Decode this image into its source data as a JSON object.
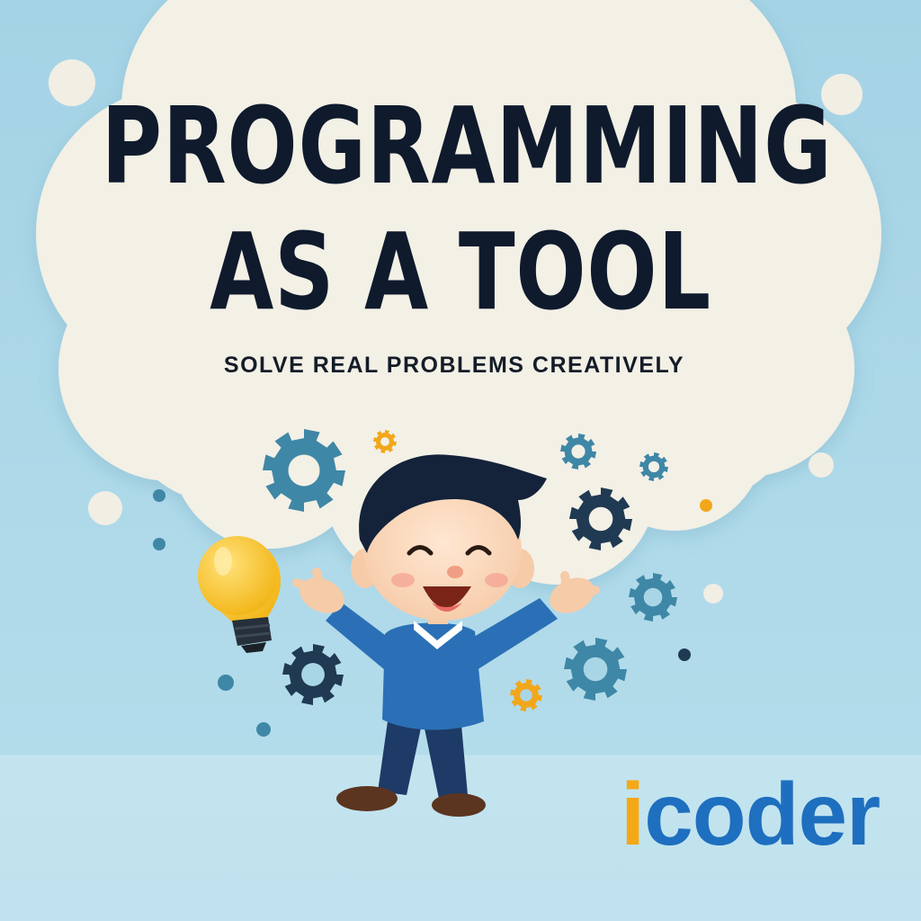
{
  "poster": {
    "headline_line1": "PROGRAMMING",
    "headline_line2": "AS A TOOL",
    "subtitle": "SOLVE REAL PROBLEMS CREATIVELY"
  },
  "logo": {
    "letter_i": "i",
    "rest": "coder",
    "colors": {
      "i": "#f5a817",
      "rest": "#1e6fbf"
    }
  },
  "palette": {
    "background": "#a9d6e6",
    "cloud": "#f3f0e6",
    "text": "#0f1a2c",
    "gear_teal": "#3f87a6",
    "gear_navy": "#1f3a52",
    "gear_orange": "#f2a71b",
    "shirt": "#2b70b6",
    "pants": "#1e3a66"
  },
  "decorations": {
    "icons": [
      "cloud-icon",
      "gear-icon",
      "lightbulb-icon",
      "cartoon-boy"
    ]
  }
}
